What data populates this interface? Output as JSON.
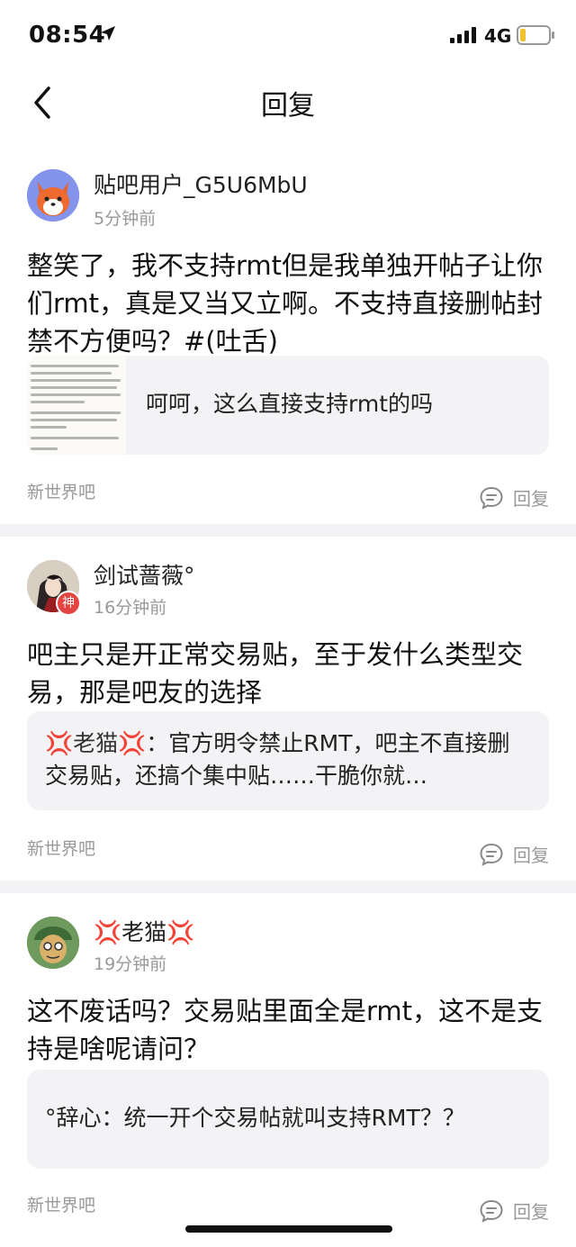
{
  "status_bar": {
    "time": "08:54",
    "network": "4G"
  },
  "nav": {
    "title": "回复"
  },
  "posts": [
    {
      "username": "贴吧用户_G5U6MbU",
      "time": "5分钟前",
      "content": "整笑了，我不支持rmt但是我单独开帖子让你们rmt，真是又当又立啊。不支持直接删帖封禁不方便吗？#(吐舌)",
      "quote": "呵呵，这么直接支持rmt的吗",
      "forum": "新世界吧",
      "reply_label": "回复"
    },
    {
      "username": "剑试蔷薇°",
      "badge": "神",
      "time": "16分钟前",
      "content": "吧主只是开正常交易贴，至于发什么类型交易，那是吧友的选择",
      "quote_prefix": "💢老猫💢",
      "quote": "：官方明令禁止RMT，吧主不直接删交易贴，还搞个集中贴……干脆你就…",
      "forum": "新世界吧",
      "reply_label": "回复"
    },
    {
      "username": "💢老猫💢",
      "time": "19分钟前",
      "content": "这不废话吗？交易贴里面全是rmt，这不是支持是啥呢请问？",
      "quote": "°辞心：统一开个交易帖就叫支持RMT？？",
      "forum": "新世界吧",
      "reply_label": "回复"
    }
  ]
}
